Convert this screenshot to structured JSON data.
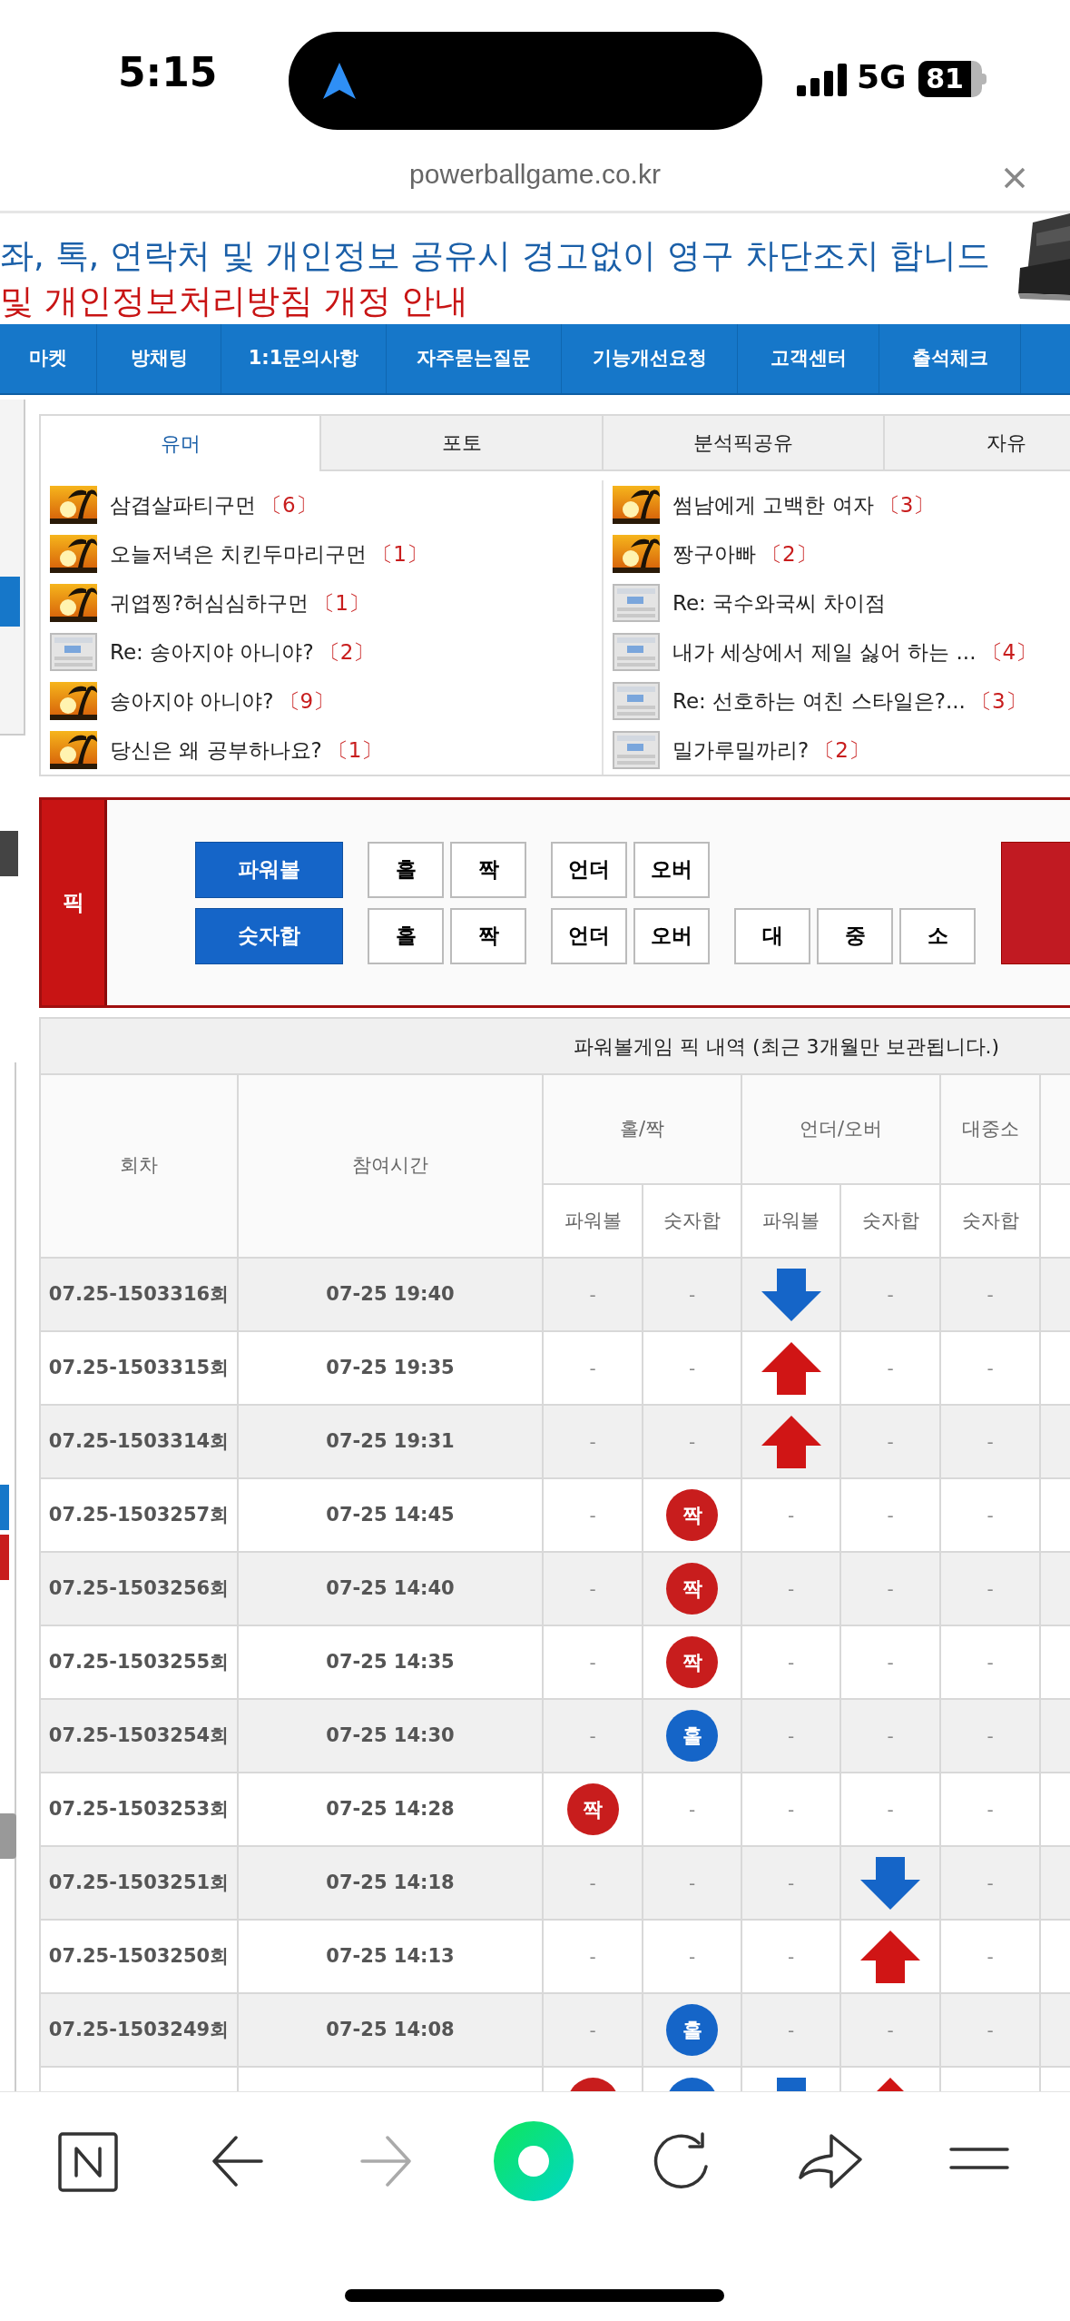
{
  "status_bar": {
    "time": "5:15",
    "network": "5G",
    "battery": "81"
  },
  "address_bar": {
    "url": "powerballgame.co.kr"
  },
  "notices": [
    {
      "kind": "warning",
      "text": "좌, 톡, 연락처 및 개인정보 공유시 경고없이 영구 차단조치 합니드"
    },
    {
      "kind": "notice",
      "text": "및 개인정보처리방침 개정 안내"
    }
  ],
  "nav": [
    "마켓",
    "방채팅",
    "1:1문의사항",
    "자주묻는질문",
    "기능개선요청",
    "고객센터",
    "출석체크"
  ],
  "board_tabs": [
    {
      "label": "유머",
      "selected": true
    },
    {
      "label": "포토",
      "selected": false
    },
    {
      "label": "분석픽공유",
      "selected": false
    },
    {
      "label": "자유",
      "selected": false
    }
  ],
  "posts_left": [
    {
      "title": "삼겹살파티구먼",
      "count": "〔6〕"
    },
    {
      "title": "오늘저녁은 치킨두마리구먼",
      "count": "〔1〕"
    },
    {
      "title": "귀엽찡?허심심하구먼",
      "count": "〔1〕"
    },
    {
      "kind": "doc",
      "title": "Re: 송아지야 아니야?",
      "count": "〔2〕"
    },
    {
      "title": "송아지야 아니야?",
      "count": "〔9〕"
    },
    {
      "title": "당신은 왜 공부하나요?",
      "count": "〔1〕"
    }
  ],
  "posts_right": [
    {
      "title": "썸남에게 고백한 여자",
      "count": "〔3〕"
    },
    {
      "title": "짱구아빠",
      "count": "〔2〕"
    },
    {
      "kind": "doc",
      "title": "Re: 국수와국씨 차이점"
    },
    {
      "kind": "doc",
      "title": "내가 세상에서 제일 싫어 하는 ...",
      "count": "〔4〕"
    },
    {
      "kind": "doc",
      "title": "Re: 선호하는 여친 스타일은?...",
      "count": "〔3〕"
    },
    {
      "kind": "doc",
      "title": "밀가루밀까리?",
      "count": "〔2〕"
    }
  ],
  "pick_panel": {
    "label": "픽",
    "rows": [
      {
        "name": "파워볼",
        "groups": [
          [
            "홀",
            "짝"
          ],
          [
            "언더",
            "오버"
          ]
        ]
      },
      {
        "name": "숫자합",
        "groups": [
          [
            "홀",
            "짝"
          ],
          [
            "언더",
            "오버"
          ],
          [
            "대",
            "중",
            "소"
          ]
        ]
      }
    ]
  },
  "history": {
    "title": "파워볼게임 픽 내역 (최근 3개월만 보관됩니다.)",
    "round_header": "회차",
    "time_header": "참여시간",
    "groups": [
      {
        "label": "홀/짝",
        "subs": [
          "파워볼",
          "숫자합"
        ]
      },
      {
        "label": "언더/오버",
        "subs": [
          "파워볼",
          "숫자합"
        ]
      },
      {
        "label": "대중소",
        "subs": [
          "숫자합"
        ]
      }
    ],
    "rows": [
      {
        "round": "07.25-1503316회",
        "time": "07-25 19:40",
        "cells": [
          {
            "kind": "dash",
            "text": "-"
          },
          {
            "kind": "dash",
            "text": "-"
          },
          {
            "kind": "down_arrow"
          },
          {
            "kind": "dash",
            "text": "-"
          },
          {
            "kind": "dash",
            "text": "-"
          }
        ]
      },
      {
        "round": "07.25-1503315회",
        "time": "07-25 19:35",
        "cells": [
          {
            "kind": "dash",
            "text": "-"
          },
          {
            "kind": "dash",
            "text": "-"
          },
          {
            "kind": "up_arrow"
          },
          {
            "kind": "dash",
            "text": "-"
          },
          {
            "kind": "dash",
            "text": "-"
          }
        ]
      },
      {
        "round": "07.25-1503314회",
        "time": "07-25 19:31",
        "cells": [
          {
            "kind": "dash",
            "text": "-"
          },
          {
            "kind": "dash",
            "text": "-"
          },
          {
            "kind": "up_arrow"
          },
          {
            "kind": "dash",
            "text": "-"
          },
          {
            "kind": "dash",
            "text": "-"
          }
        ]
      },
      {
        "round": "07.25-1503257회",
        "time": "07-25 14:45",
        "cells": [
          {
            "kind": "dash",
            "text": "-"
          },
          {
            "kind": "ball",
            "text": "짝",
            "color": "#c81d1d"
          },
          {
            "kind": "dash",
            "text": "-"
          },
          {
            "kind": "dash",
            "text": "-"
          },
          {
            "kind": "dash",
            "text": "-"
          }
        ]
      },
      {
        "round": "07.25-1503256회",
        "time": "07-25 14:40",
        "cells": [
          {
            "kind": "dash",
            "text": "-"
          },
          {
            "kind": "ball",
            "text": "짝",
            "color": "#c81d1d"
          },
          {
            "kind": "dash",
            "text": "-"
          },
          {
            "kind": "dash",
            "text": "-"
          },
          {
            "kind": "dash",
            "text": "-"
          }
        ]
      },
      {
        "round": "07.25-1503255회",
        "time": "07-25 14:35",
        "cells": [
          {
            "kind": "dash",
            "text": "-"
          },
          {
            "kind": "ball",
            "text": "짝",
            "color": "#c81d1d"
          },
          {
            "kind": "dash",
            "text": "-"
          },
          {
            "kind": "dash",
            "text": "-"
          },
          {
            "kind": "dash",
            "text": "-"
          }
        ]
      },
      {
        "round": "07.25-1503254회",
        "time": "07-25 14:30",
        "cells": [
          {
            "kind": "dash",
            "text": "-"
          },
          {
            "kind": "ball",
            "text": "홀",
            "color": "#1565c8"
          },
          {
            "kind": "dash",
            "text": "-"
          },
          {
            "kind": "dash",
            "text": "-"
          },
          {
            "kind": "dash",
            "text": "-"
          }
        ]
      },
      {
        "round": "07.25-1503253회",
        "time": "07-25 14:28",
        "cells": [
          {
            "kind": "ball",
            "text": "짝",
            "color": "#c81d1d"
          },
          {
            "kind": "dash",
            "text": "-"
          },
          {
            "kind": "dash",
            "text": "-"
          },
          {
            "kind": "dash",
            "text": "-"
          },
          {
            "kind": "dash",
            "text": "-"
          }
        ]
      },
      {
        "round": "07.25-1503251회",
        "time": "07-25 14:18",
        "cells": [
          {
            "kind": "dash",
            "text": "-"
          },
          {
            "kind": "dash",
            "text": "-"
          },
          {
            "kind": "dash",
            "text": "-"
          },
          {
            "kind": "down_arrow"
          },
          {
            "kind": "dash",
            "text": "-"
          }
        ]
      },
      {
        "round": "07.25-1503250회",
        "time": "07-25 14:13",
        "cells": [
          {
            "kind": "dash",
            "text": "-"
          },
          {
            "kind": "dash",
            "text": "-"
          },
          {
            "kind": "dash",
            "text": "-"
          },
          {
            "kind": "up_arrow"
          },
          {
            "kind": "dash",
            "text": "-"
          }
        ]
      },
      {
        "round": "07.25-1503249회",
        "time": "07-25 14:08",
        "cells": [
          {
            "kind": "dash",
            "text": "-"
          },
          {
            "kind": "ball",
            "text": "홀",
            "color": "#1565c8"
          },
          {
            "kind": "dash",
            "text": "-"
          },
          {
            "kind": "dash",
            "text": "-"
          },
          {
            "kind": "dash",
            "text": "-"
          }
        ]
      },
      {
        "cells": [
          {
            "kind": "ball",
            "color": "#c81d1d"
          },
          {
            "kind": "ball",
            "color": "#1565c8"
          },
          {
            "kind": "down_arrow"
          },
          {
            "kind": "up_arrow"
          }
        ]
      }
    ]
  }
}
